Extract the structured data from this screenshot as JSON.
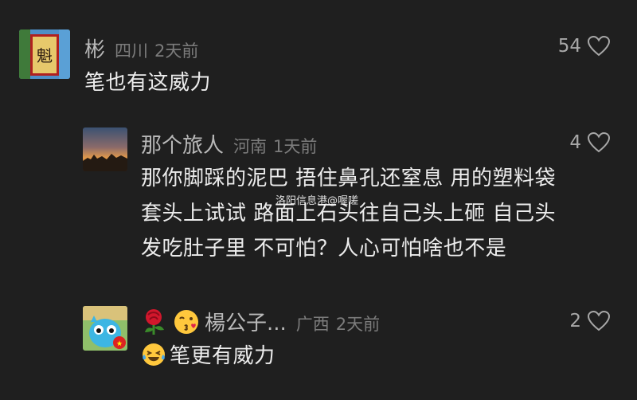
{
  "comments": [
    {
      "username": "彬",
      "region": "四川",
      "time": "2天前",
      "likes": "54",
      "text_lines": [
        "笔也有这威力"
      ]
    },
    {
      "username": "那个旅人",
      "region": "河南",
      "time": "1天前",
      "likes": "4",
      "text_lines": [
        "那你脚踩的泥巴 捂住鼻孔还窒息 用的塑料袋",
        "套头上试试  路面上石头往自己头上砸 自己头",
        "发吃肚子里 不可怕？人心可怕啥也不是"
      ]
    },
    {
      "username": "楊公子...",
      "username_emojis": [
        "rose-emoji",
        "kiss-emoji"
      ],
      "region": "广西",
      "time": "2天前",
      "likes": "2",
      "text_lines": [
        "笔更有威力"
      ],
      "text_emoji": "laughing-tears-emoji"
    }
  ],
  "watermark": "洛阳信息港@喔嗟",
  "colors": {
    "background": "#1f1f1f",
    "username": "#b9b9b9",
    "meta": "#7c7c7c",
    "text": "#ececec"
  }
}
